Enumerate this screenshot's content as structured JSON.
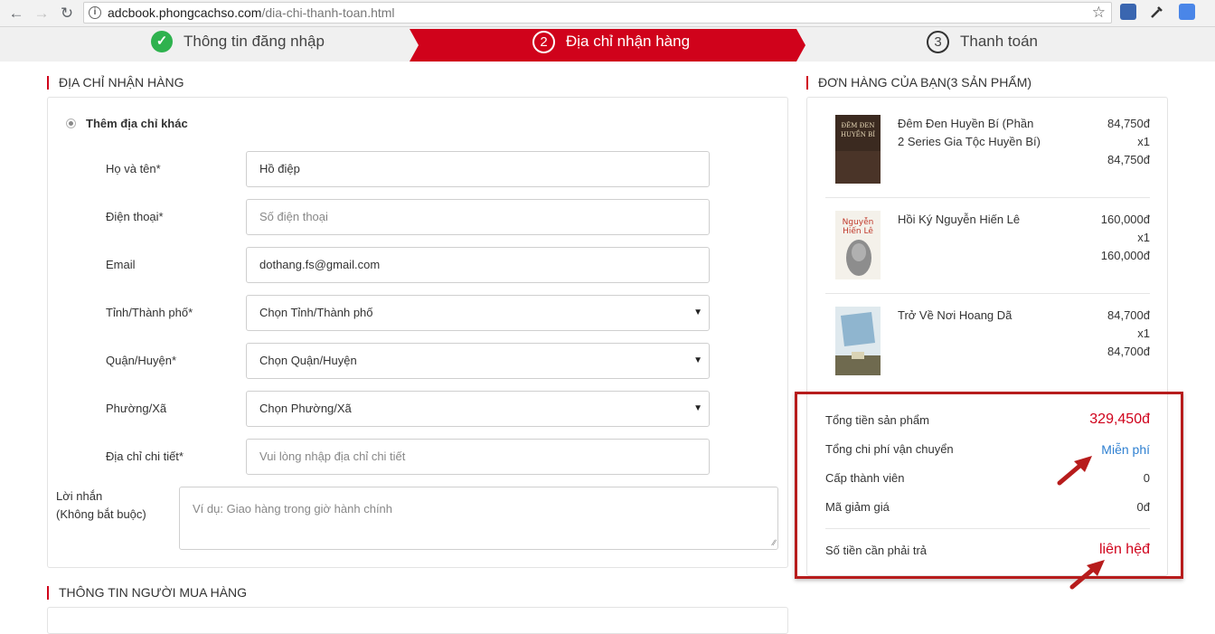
{
  "browser": {
    "back_icon": "arrow-left-icon",
    "forward_icon": "arrow-right-icon",
    "reload_icon": "reload-icon",
    "url_host": "adcbook.phongcachso.com",
    "url_path": "/dia-chi-thanh-toan.html"
  },
  "steps": [
    {
      "label": "Thông tin đăng nhập",
      "status": "done"
    },
    {
      "number": "2",
      "label": "Địa chỉ nhận hàng",
      "status": "active"
    },
    {
      "number": "3",
      "label": "Thanh toán",
      "status": "pending"
    }
  ],
  "address": {
    "title": "ĐỊA CHỈ NHẬN HÀNG",
    "option": "Thêm địa chỉ khác",
    "fields": [
      {
        "label": "Họ và tên*",
        "value": "Hồ điệp",
        "placeholder": ""
      },
      {
        "label": "Điện thoại*",
        "value": "",
        "placeholder": "Số điện thoại"
      },
      {
        "label": "Email",
        "value": "dothang.fs@gmail.com",
        "placeholder": ""
      },
      {
        "label": "Tỉnh/Thành phố*",
        "value": "Chọn Tỉnh/Thành phố",
        "placeholder": ""
      },
      {
        "label": "Quận/Huyện*",
        "value": "Chọn Quận/Huyện",
        "placeholder": ""
      },
      {
        "label": "Phường/Xã",
        "value": "Chọn Phường/Xã",
        "placeholder": ""
      },
      {
        "label": "Địa chỉ chi tiết*",
        "value": "",
        "placeholder": "Vui lòng nhập địa chỉ chi tiết"
      }
    ],
    "message_label_1": "Lời nhắn",
    "message_label_2": "(Không bắt buộc)",
    "message_placeholder": "Ví dụ: Giao hàng trong giờ hành chính"
  },
  "buyer": {
    "title": "THÔNG TIN NGƯỜI MUA HÀNG"
  },
  "order": {
    "title": "ĐƠN HÀNG CỦA BẠN(3 Sản phẩm)",
    "products": [
      {
        "name": "Đêm Đen Huyền Bí (Phần 2 Series Gia Tộc Huyền Bí)",
        "price": "84,750đ",
        "qty": "x1",
        "total": "84,750đ",
        "cover_text": "ĐÊM ĐEN HUYỀN BÍ"
      },
      {
        "name": "Hồi Ký Nguyễn Hiến Lê",
        "price": "160,000đ",
        "qty": "x1",
        "total": "160,000đ",
        "cover_text": "Nguyễn Hiến Lê"
      },
      {
        "name": "Trở Về Nơi Hoang Dã",
        "price": "84,700đ",
        "qty": "x1",
        "total": "84,700đ",
        "cover_text": ""
      }
    ],
    "summary": {
      "subtotal_label": "Tổng tiền sản phẩm",
      "subtotal_value": "329,450đ",
      "shipping_label": "Tổng chi phí vận chuyển",
      "shipping_value": "Miễn phí",
      "member_label": "Cấp thành viên",
      "member_value": "0",
      "discount_label": "Mã giảm giá",
      "discount_value": "0đ",
      "total_label": "Số tiền cần phải trả",
      "total_value": "liên hệđ"
    }
  },
  "colors": {
    "accent": "#d0021b",
    "success": "#2eb24e",
    "link": "#2f80d1",
    "annotation": "#b71c1c"
  }
}
